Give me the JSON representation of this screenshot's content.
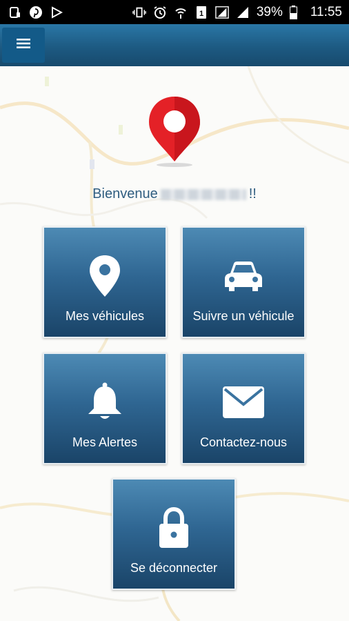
{
  "status_bar": {
    "battery_percent": "39%",
    "time": "11:55",
    "left_icons": [
      "notification-icon",
      "pinterest-icon",
      "play-store-icon"
    ],
    "right_icons": [
      "vibrate-icon",
      "alarm-icon",
      "hotspot-icon",
      "sim-icon",
      "signal-icon",
      "signal-icon",
      "battery-icon"
    ]
  },
  "app_bar": {
    "menu_icon": "hamburger-menu-icon"
  },
  "welcome": {
    "prefix": "Bienvenue",
    "suffix": "!!"
  },
  "tiles": [
    {
      "label": "Mes véhicules",
      "icon": "location-pin-icon"
    },
    {
      "label": "Suivre un véhicule",
      "icon": "car-icon"
    },
    {
      "label": "Mes Alertes",
      "icon": "bell-icon"
    },
    {
      "label": "Contactez-nous",
      "icon": "envelope-icon"
    },
    {
      "label": "Se déconnecter",
      "icon": "lock-icon"
    }
  ],
  "colors": {
    "tile_top": "#4d8ab4",
    "tile_bottom": "#1a4468",
    "app_bar": "#1d5a82",
    "logo_red": "#e42127",
    "welcome_text": "#2f5d80"
  }
}
